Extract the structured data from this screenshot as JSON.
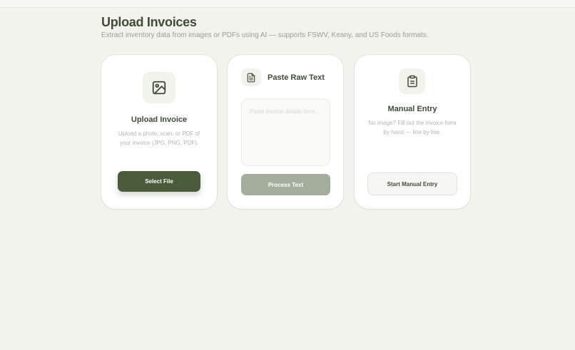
{
  "header": {
    "title": "Upload Invoices",
    "subtitle": "Extract inventory data from images or PDFs using AI — supports FSWV, Keany, and US Foods formats."
  },
  "theme": {
    "background": "#f3f3ee",
    "card": "#ffffff",
    "primary": "#4a5b3c",
    "primary_disabled": "#a3ae9a",
    "text": "#3f4d37",
    "muted": "#b4b6ae"
  },
  "cards": {
    "upload": {
      "icon": "image-icon",
      "title": "Upload Invoice",
      "description": "Upload a photo, scan, or PDF of your invoice (JPG, PNG, PDF).",
      "button_label": "Select File"
    },
    "paste": {
      "icon": "document-icon",
      "title": "Paste Raw Text",
      "textarea_value": "",
      "textarea_placeholder": "Paste invoice details here...",
      "button_label": "Process Text"
    },
    "manual": {
      "icon": "clipboard-icon",
      "title": "Manual Entry",
      "description": "No image? Fill out the invoice form by hand — line by line.",
      "button_label": "Start Manual Entry"
    }
  }
}
